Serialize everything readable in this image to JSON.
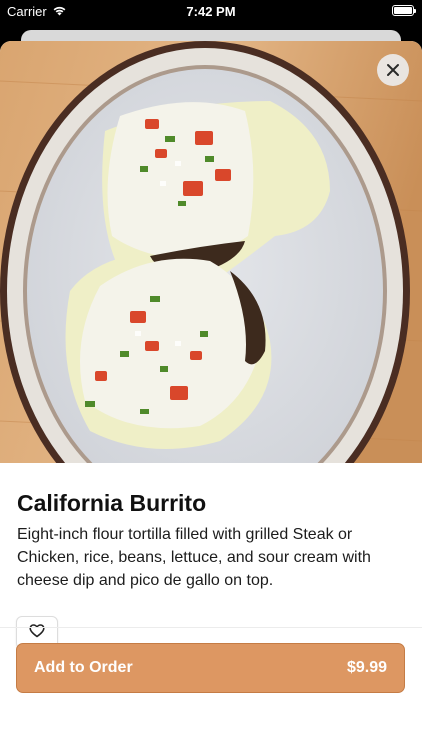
{
  "status_bar": {
    "carrier": "Carrier",
    "time": "7:42 PM",
    "wifi_icon": "wifi-icon",
    "battery_icon": "battery-icon"
  },
  "item": {
    "image": "burrito-plate-photo",
    "title": "California Burrito",
    "description": "Eight-inch flour tortilla filled with grilled Steak or Chicken, rice, beans, lettuce, and sour cream with cheese dip and pico de gallo on top."
  },
  "actions": {
    "close_icon": "close-icon",
    "favorite_icon": "heart-icon",
    "add_label": "Add to Order",
    "price": "$9.99"
  },
  "colors": {
    "accent": "#dd9762",
    "accent_border": "#c57c45",
    "text": "#111111"
  }
}
